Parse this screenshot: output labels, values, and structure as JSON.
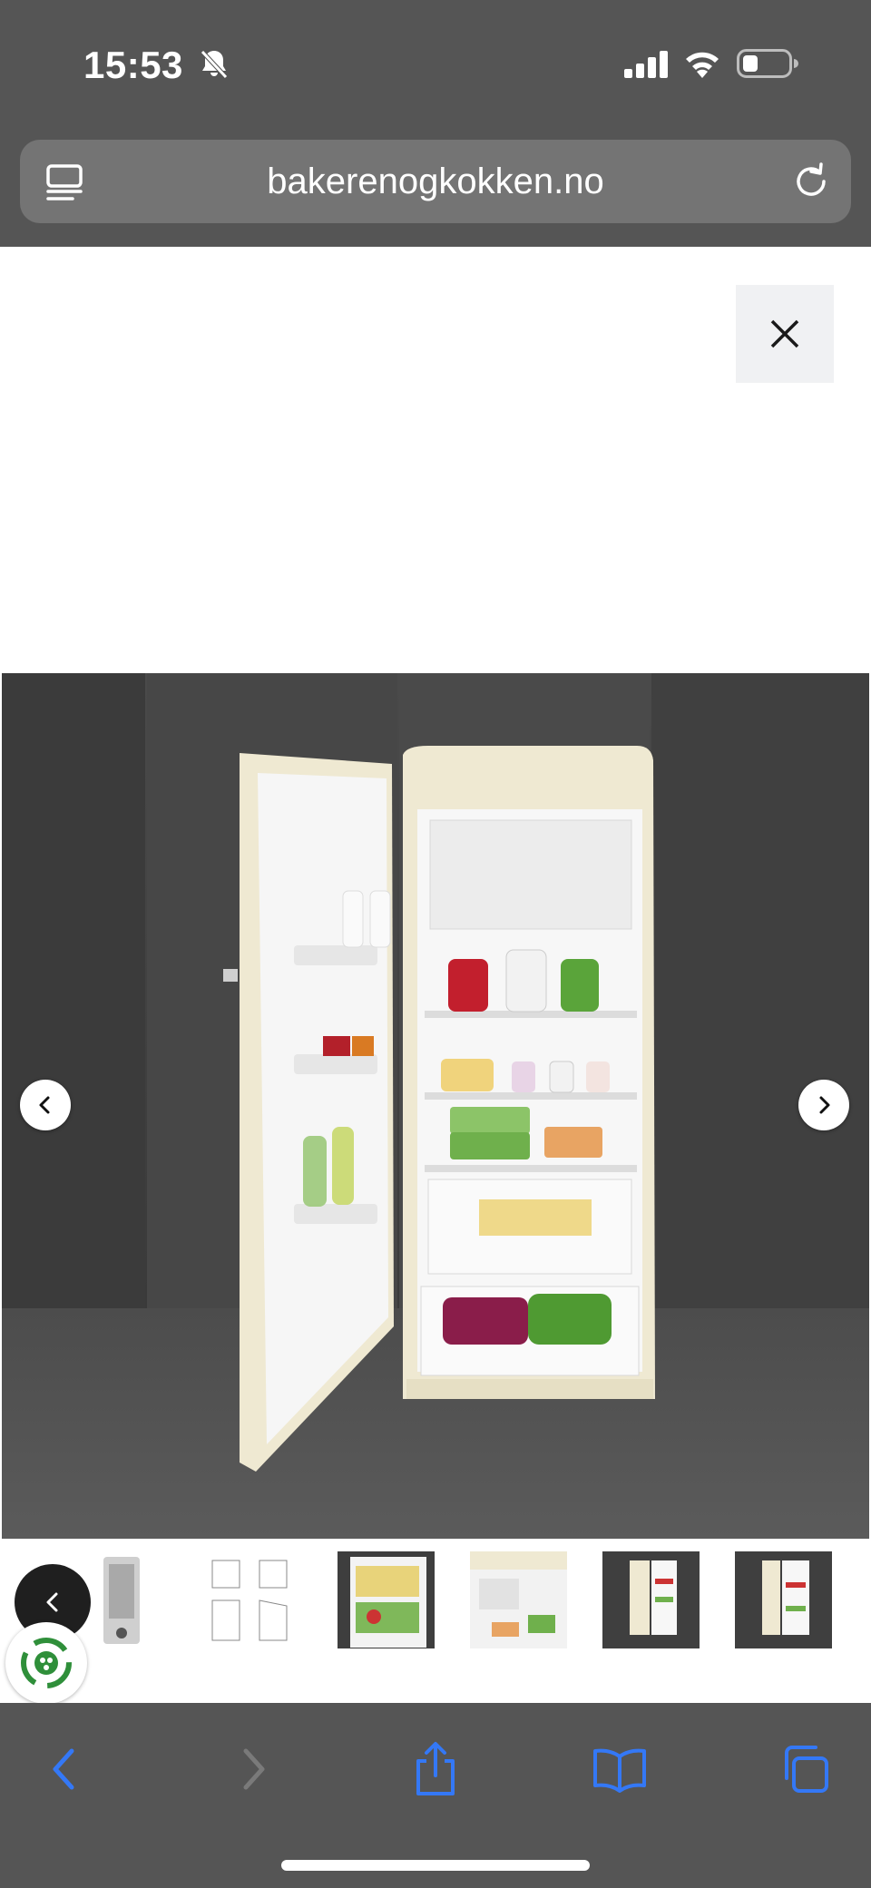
{
  "status_bar": {
    "time": "15:53",
    "battery_level": 0.25
  },
  "browser": {
    "url": "bakerenogkokken.no"
  },
  "gallery": {
    "thumbnail_count": 6,
    "colors": {
      "accent": "#3478f6",
      "background": "#555555"
    }
  },
  "icons": {
    "reader": "reader-mode-icon",
    "reload": "reload-icon",
    "close": "close-icon",
    "prev": "chevron-left-icon",
    "next": "chevron-right-icon",
    "eco": "eco-badge-icon",
    "back": "back-icon",
    "forward": "forward-icon",
    "share": "share-icon",
    "bookmarks": "bookmarks-icon",
    "tabs": "tabs-icon"
  }
}
